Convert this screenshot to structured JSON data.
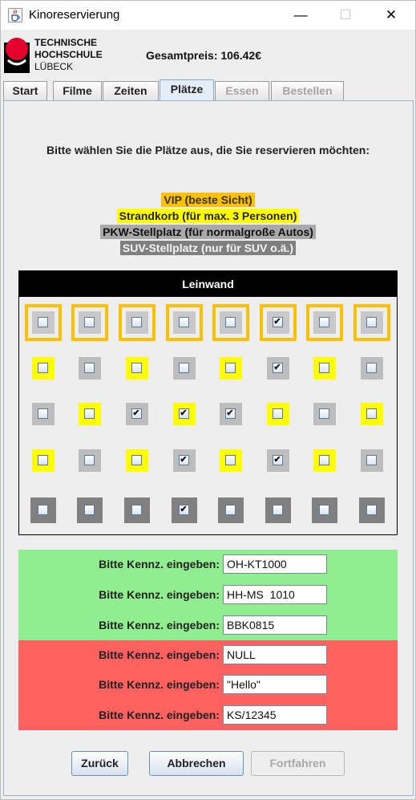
{
  "window": {
    "title": "Kinoreservierung",
    "icon": "java-cup-icon",
    "controls": {
      "minimize": "—",
      "maximize": "☐",
      "close": "✕"
    }
  },
  "header": {
    "logo_lines": [
      "TECHNISCHE",
      "HOCHSCHULE",
      "LÜBECK"
    ],
    "total_price": "Gesamtpreis: 106.42€"
  },
  "tabs": [
    {
      "label": "Start",
      "state": "normal"
    },
    {
      "label": "Filme",
      "state": "normal"
    },
    {
      "label": "Zeiten",
      "state": "normal"
    },
    {
      "label": "Plätze",
      "state": "active"
    },
    {
      "label": "Essen",
      "state": "disabled"
    },
    {
      "label": "Bestellen",
      "state": "disabled"
    }
  ],
  "instruction": "Bitte wählen Sie die Plätze aus, die Sie reservieren möchten:",
  "legend": {
    "vip": "VIP (beste Sicht)",
    "strandkorb": "Strandkorb (für max. 3 Personen)",
    "pkw": "PKW-Stellplatz (für normalgroße Autos)",
    "suv": "SUV-Stellplatz (nur für SUV o.ä.)"
  },
  "colors": {
    "vip": "#ffc000",
    "strandkorb": "#ffff00",
    "pkw": "#a9a9a9",
    "suv": "#808080",
    "valid": "#90ee90",
    "invalid": "#ff6060"
  },
  "screen_label": "Leinwand",
  "seat_rows": [
    {
      "types": [
        "vip",
        "vip",
        "vip",
        "vip",
        "vip",
        "vip",
        "vip",
        "vip"
      ],
      "checked": [
        false,
        false,
        false,
        false,
        false,
        true,
        false,
        false
      ]
    },
    {
      "types": [
        "strand",
        "pkw",
        "strand",
        "pkw",
        "strand",
        "pkw",
        "strand",
        "pkw"
      ],
      "checked": [
        false,
        false,
        false,
        false,
        false,
        true,
        false,
        false
      ]
    },
    {
      "types": [
        "pkw",
        "strand",
        "pkw",
        "strand",
        "pkw",
        "strand",
        "pkw",
        "strand"
      ],
      "checked": [
        false,
        false,
        true,
        true,
        true,
        false,
        false,
        false
      ]
    },
    {
      "types": [
        "strand",
        "pkw",
        "strand",
        "pkw",
        "strand",
        "pkw",
        "strand",
        "pkw"
      ],
      "checked": [
        false,
        false,
        false,
        true,
        false,
        true,
        false,
        false
      ]
    },
    {
      "types": [
        "suv",
        "suv",
        "suv",
        "suv",
        "suv",
        "suv",
        "suv",
        "suv"
      ],
      "checked": [
        false,
        false,
        false,
        true,
        false,
        false,
        false,
        false
      ]
    }
  ],
  "plates": {
    "label": "Bitte Kennz. eingeben:",
    "valid": [
      "OH-KT1000",
      "HH-MS  1010",
      "BBK0815"
    ],
    "invalid": [
      "NULL",
      "\"Hello\"",
      "KS/12345"
    ]
  },
  "buttons": {
    "back": "Zurück",
    "cancel": "Abbrechen",
    "next": "Fortfahren"
  }
}
